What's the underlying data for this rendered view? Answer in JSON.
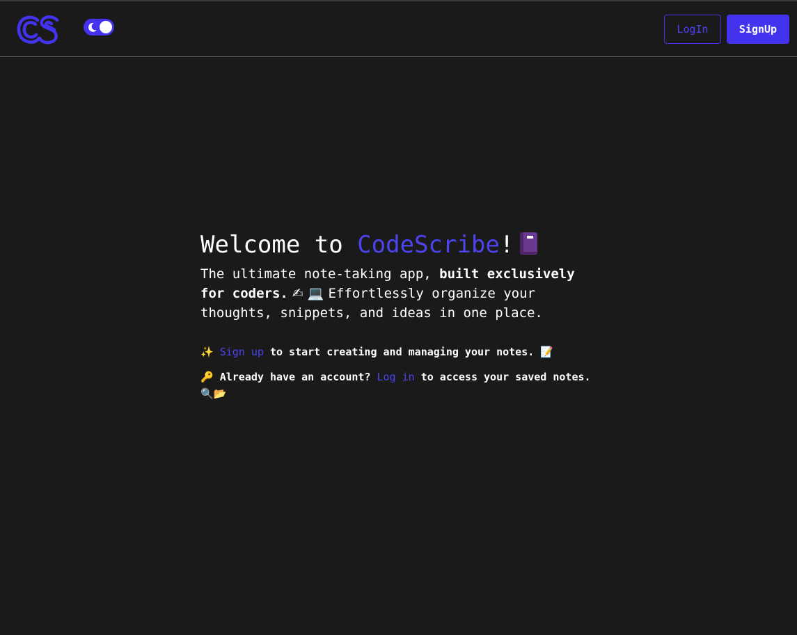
{
  "header": {
    "logo_text": "CS",
    "theme_toggle": "dark-mode",
    "login_label": "LogIn",
    "signup_label": "SignUp"
  },
  "hero": {
    "title_prefix": "Welcome to ",
    "title_brand": "CodeScribe",
    "title_suffix": "!",
    "book_icon": "notebook-icon",
    "lead_start": "The ultimate note-taking app, ",
    "lead_bold": "built exclusively for coders.",
    "lead_emojis": " ✍ 💻 ",
    "lead_end": "Effortlessly organize your thoughts, snippets, and ideas in one place."
  },
  "signup_line": {
    "emoji": "✨",
    "link": "Sign up",
    "text": " to start creating and managing your notes. ",
    "emoji_end": "📝"
  },
  "login_line": {
    "emoji": "🔑",
    "prefix": " Already have an account? ",
    "link": "Log in",
    "text": " to access your saved notes. ",
    "emoji_end": "🔍📂"
  },
  "colors": {
    "background": "#1a1a1a",
    "accent": "#4433ee",
    "text": "#ffffff"
  }
}
